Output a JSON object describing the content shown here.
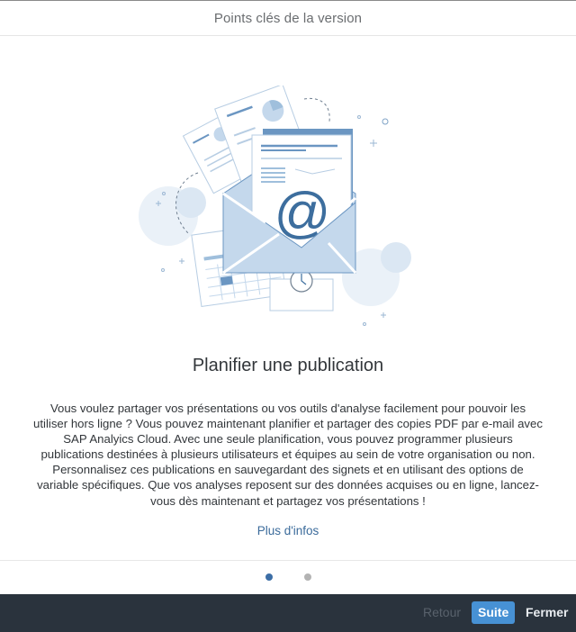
{
  "dialog": {
    "title": "Points clés de la version"
  },
  "slide": {
    "illustration": "email-publication-illustration",
    "title": "Planifier une publication",
    "description": "Vous voulez partager vos présentations ou vos outils d'analyse facilement pour pouvoir les utiliser hors ligne ? Vous pouvez maintenant planifier et partager des copies PDF par e-mail avec SAP Analyics Cloud. Avec une seule planification, vous pouvez programmer plusieurs publications destinées à plusieurs utilisateurs et équipes au sein de votre organisation ou non. Personnalisez ces publications en sauvegardant des signets et en utilisant des options de variable spécifiques. Que vos analyses reposent sur des données acquises ou en ligne, lancez-vous dès maintenant et partagez vos présentations !",
    "more_link": "Plus d'infos"
  },
  "pager": {
    "total": 2,
    "current": 1
  },
  "footer": {
    "back_label": "Retour",
    "next_label": "Suite",
    "close_label": "Fermer"
  },
  "colors": {
    "accent": "#4791d4",
    "footer_bg": "#2a333d",
    "link": "#3b6b9b",
    "illustration_primary": "#3d6e9e",
    "illustration_fill": "#c4d8ec"
  }
}
